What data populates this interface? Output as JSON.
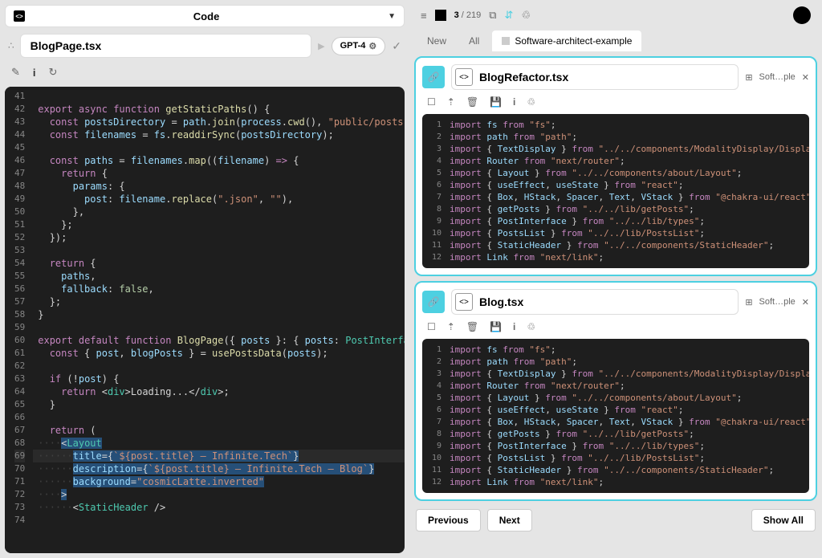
{
  "typeSelector": {
    "label": "Code"
  },
  "leftFile": {
    "title": "BlogPage.tsx",
    "model": "GPT-4"
  },
  "topBar": {
    "currentPage": "3",
    "totalPages": "219"
  },
  "tabs": {
    "new": "New",
    "all": "All",
    "active": "Software-architect-example"
  },
  "card1": {
    "title": "BlogRefactor.tsx",
    "badge": "Soft…ple"
  },
  "card2": {
    "title": "Blog.tsx",
    "badge": "Soft…ple"
  },
  "bottomButtons": {
    "prev": "Previous",
    "next": "Next",
    "showAll": "Show All"
  },
  "leftCode": {
    "startLine": 41,
    "lines": [
      "",
      "<kw>export</kw> <kw>async</kw> <kw>function</kw> <fn>getStaticPaths</fn>() {",
      "  <kw>const</kw> <var>postsDirectory</var> = <var>path</var>.<fn>join</fn>(<var>process</var>.<fn>cwd</fn>(), <str>\"public/posts\"</str>);",
      "  <kw>const</kw> <var>filenames</var> = <var>fs</var>.<fn>readdirSync</fn>(<var>postsDirectory</var>);",
      "",
      "  <kw>const</kw> <var>paths</var> = <var>filenames</var>.<fn>map</fn>((<var>filename</var>) <kw>=></kw> {",
      "    <kw>return</kw> {",
      "      <var>params</var>: {",
      "        <var>post</var>: <var>filename</var>.<fn>replace</fn>(<str>\".json\"</str>, <str>\"\"</str>),",
      "      },",
      "    };",
      "  });",
      "",
      "  <kw>return</kw> {",
      "    <var>paths</var>,",
      "    <var>fallback</var>: <num>false</num>,",
      "  };",
      "}",
      "",
      "<kw>export</kw> <kw>default</kw> <kw>function</kw> <fn>BlogPage</fn>({ <var>posts</var> }: { <var>posts</var>: <typ>PostInterface</typ>[] }",
      "  <kw>const</kw> { <var>post</var>, <var>blogPosts</var> } = <fn>usePostsData</fn>(<var>posts</var>);",
      "",
      "  <kw>if</kw> (!<var>post</var>) {",
      "    <kw>return</kw> &lt;<typ>div</typ>&gt;Loading...&lt;/<typ>div</typ>&gt;;",
      "  }",
      "",
      "  <kw>return</kw> (",
      "<span class='indent-dots'>····</span><span class='hl'>&lt;<typ>Layout</typ></span>",
      "<span class='indent-dots'>······</span><span class='hl'><var>title</var>={<str>`${post.title} — Infinite.Tech`</str>}</span>",
      "<span class='indent-dots'>······</span><span class='hl'><var>description</var>={<str>`${post.title} — Infinite.Tech — Blog`</str>}</span>",
      "<span class='indent-dots'>······</span><span class='hl'><var>background</var>=<str>\"cosmicLatte.inverted\"</str></span>",
      "<span class='indent-dots'>····</span><span class='hl'>&gt;</span>",
      "<span class='indent-dots'>······</span>&lt;<typ>StaticHeader</typ> /&gt;",
      ""
    ]
  },
  "rightCode": {
    "lines": [
      "<kw>import</kw> <var>fs</var> <kw>from</kw> <str>\"fs\"</str>;",
      "<kw>import</kw> <var>path</var> <kw>from</kw> <str>\"path\"</str>;",
      "<kw>import</kw> { <var>TextDisplay</var> } <kw>from</kw> <str>\"../../components/ModalityDisplay/Display</str>",
      "<kw>import</kw> <var>Router</var> <kw>from</kw> <str>\"next/router\"</str>;",
      "<kw>import</kw> { <var>Layout</var> } <kw>from</kw> <str>\"../../components/about/Layout\"</str>;",
      "<kw>import</kw> { <var>useEffect</var>, <var>useState</var> } <kw>from</kw> <str>\"react\"</str>;",
      "<kw>import</kw> { <var>Box</var>, <var>HStack</var>, <var>Spacer</var>, <var>Text</var>, <var>VStack</var> } <kw>from</kw> <str>\"@chakra-ui/react\"</str>;",
      "<kw>import</kw> { <var>getPosts</var> } <kw>from</kw> <str>\"../../lib/getPosts\"</str>;",
      "<kw>import</kw> { <var>PostInterface</var> } <kw>from</kw> <str>\"../../lib/types\"</str>;",
      "<kw>import</kw> { <var>PostsList</var> } <kw>from</kw> <str>\"../../lib/PostsList\"</str>;",
      "<kw>import</kw> { <var>StaticHeader</var> } <kw>from</kw> <str>\"../../components/StaticHeader\"</str>;",
      "<kw>import</kw> <var>Link</var> <kw>from</kw> <str>\"next/link\"</str>;"
    ]
  }
}
